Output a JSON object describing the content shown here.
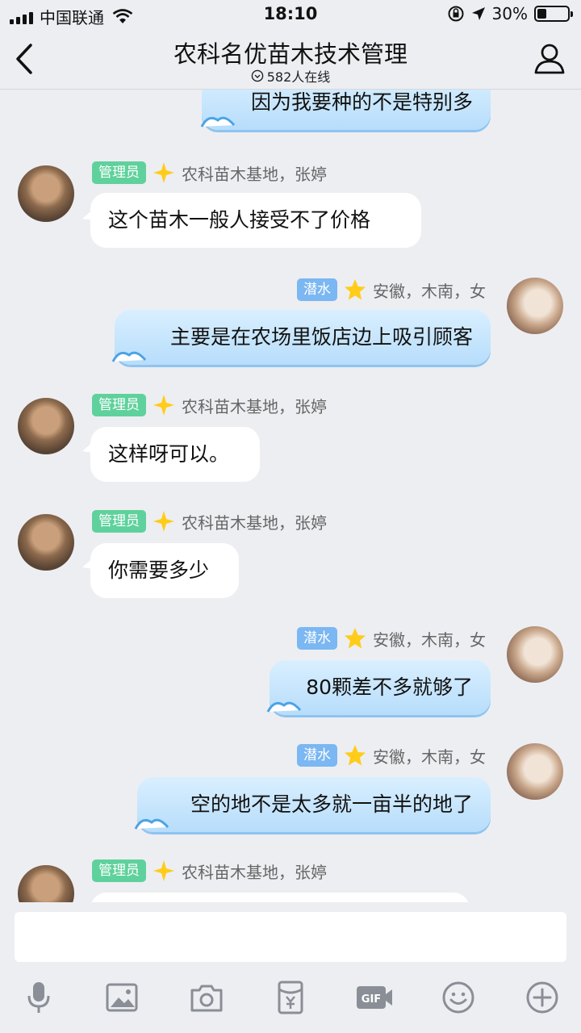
{
  "status_bar": {
    "carrier": "中国联通",
    "time": "18:10",
    "battery": "30%"
  },
  "header": {
    "title": "农科名优苗木技术管理",
    "online": "582人在线"
  },
  "messages": [
    {
      "side": "right",
      "text": "因为我要种的不是特别多"
    },
    {
      "side": "left",
      "badge": "管理员",
      "sender": "农科苗木基地，张婷",
      "text": "这个苗木一般人接受不了价格"
    },
    {
      "side": "right",
      "badge": "潜水",
      "sender": "安徽，木南，女",
      "text": "主要是在农场里饭店边上吸引顾客"
    },
    {
      "side": "left",
      "badge": "管理员",
      "sender": "农科苗木基地，张婷",
      "text": "这样呀可以。"
    },
    {
      "side": "left",
      "badge": "管理员",
      "sender": "农科苗木基地，张婷",
      "text": "你需要多少"
    },
    {
      "side": "right",
      "badge": "潜水",
      "sender": "安徽，木南，女",
      "text": "80颗差不多就够了"
    },
    {
      "side": "right",
      "badge": "潜水",
      "sender": "安徽，木南，女",
      "text": "空的地不是太多就一亩半的地了"
    },
    {
      "side": "left",
      "badge": "管理员",
      "sender": "农科苗木基地，张婷",
      "text": ""
    }
  ],
  "input": {
    "value": ""
  },
  "toolbar": [
    "mic-icon",
    "image-icon",
    "camera-icon",
    "red-packet-icon",
    "gif-icon",
    "emoji-icon",
    "plus-icon"
  ],
  "colors": {
    "admin_badge": "#5fd19c",
    "diver_badge": "#7bb7f2",
    "right_bubble": "#c5e4fc",
    "background": "#edeef2"
  }
}
